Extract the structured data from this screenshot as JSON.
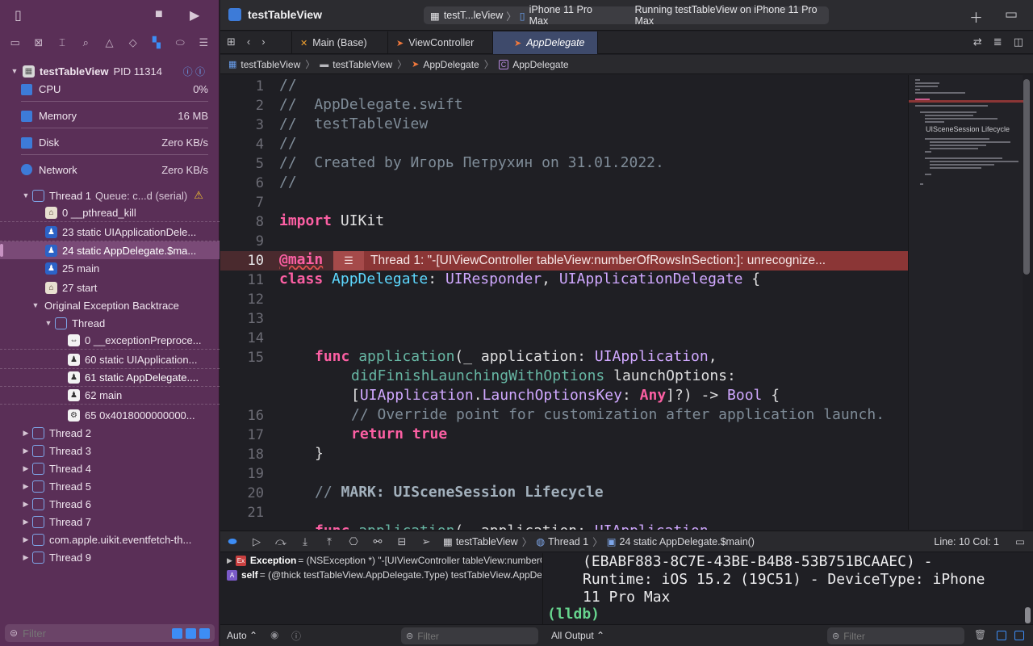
{
  "project_name": "testTableView",
  "activity": {
    "scheme": "testT...leView",
    "destination": "iPhone 11 Pro Max",
    "status": "Running testTableView on iPhone 11 Pro Max"
  },
  "process": {
    "name": "testTableView",
    "pid": "PID 11314"
  },
  "gauges": [
    {
      "label": "CPU",
      "value": "0%"
    },
    {
      "label": "Memory",
      "value": "16 MB"
    },
    {
      "label": "Disk",
      "value": "Zero KB/s"
    },
    {
      "label": "Network",
      "value": "Zero KB/s"
    }
  ],
  "thread1": {
    "label": "Thread 1",
    "queue": "Queue: c...d (serial)",
    "frames": [
      {
        "text": "0 __pthread_kill"
      },
      {
        "text": "23 static UIApplicationDele..."
      },
      {
        "text": "24 static AppDelegate.$ma..."
      },
      {
        "text": "25 main"
      },
      {
        "text": "27 start"
      }
    ]
  },
  "exception_backtrace": {
    "label": "Original Exception Backtrace",
    "thread_label": "Thread",
    "frames": [
      {
        "text": "0 __exceptionPreproce..."
      },
      {
        "text": "60 static UIApplication..."
      },
      {
        "text": "61 static AppDelegate...."
      },
      {
        "text": "62 main"
      },
      {
        "text": "65 0x4018000000000..."
      }
    ]
  },
  "threads": [
    "Thread 2",
    "Thread 3",
    "Thread 4",
    "Thread 5",
    "Thread 6",
    "Thread 7",
    "com.apple.uikit.eventfetch-th...",
    "Thread 9"
  ],
  "sidebar_filter_placeholder": "Filter",
  "tabs": [
    {
      "label": "Main (Base)"
    },
    {
      "label": "ViewController"
    },
    {
      "label": "AppDelegate"
    }
  ],
  "jumpbar": [
    "testTableView",
    "testTableView",
    "AppDelegate",
    "AppDelegate"
  ],
  "code": {
    "line_numbers": [
      "1",
      "2",
      "3",
      "4",
      "5",
      "6",
      "7",
      "8",
      "9",
      "10",
      "11",
      "12",
      "13",
      "14",
      "15",
      "",
      "",
      "16",
      "17",
      "18",
      "19",
      "20",
      "21"
    ],
    "lines": {
      "l1": "//",
      "l2": "//  AppDelegate.swift",
      "l3": "//  testTableView",
      "l4": "//",
      "l5": "//  Created by Игорь Петрухин on 31.01.2022.",
      "l6": "//",
      "l8_kw": "import",
      "l8_rest": " UIKit",
      "l10_kw": "@main",
      "l11_kw": "class",
      "l11_name": "AppDelegate",
      "l11_p1": ": ",
      "l11_t1": "UIResponder",
      "l11_p2": ", ",
      "l11_t2": "UIApplicationDelegate",
      "l11_p3": " {",
      "l15_kw": "func",
      "l15_fn": "application",
      "l15_p1": "(_ application: ",
      "l15_t1": "UIApplication",
      "l15_p2": ",",
      "l15b_fn": "didFinishLaunchingWithOptions",
      "l15b_p": " launchOptions:",
      "l15c_p1": "[",
      "l15c_t1": "UIApplication",
      "l15c_p2": ".",
      "l15c_t2": "LaunchOptionsKey",
      "l15c_p3": ": ",
      "l15c_t3": "Any",
      "l15c_p4": "]?) -> ",
      "l15c_t4": "Bool",
      "l15c_p5": " {",
      "l16": "// Override point for customization after application launch.",
      "l17_kw": "return",
      "l17_kw2": "true",
      "l18": "}",
      "l20_c": "// ",
      "l20_b": "MARK: UISceneSession Lifecycle",
      "l22_kw": "func",
      "l22_fn": "application",
      "l22_p": "(_ application: ",
      "l22_t": "UIApplication"
    },
    "error_message": "Thread 1: \"-[UIViewController tableView:numberOfRowsInSection:]: unrecognize..."
  },
  "minimap_label": "UISceneSession Lifecycle",
  "debugbar": {
    "crumbs": [
      "testTableView",
      "Thread 1",
      "24 static AppDelegate.$main()"
    ],
    "line_col": "Line: 10  Col: 1"
  },
  "variables": [
    {
      "badge": "Ex",
      "name": "Exception",
      "value": " = (NSException *) \"-[UIViewController tableView:numberO..."
    },
    {
      "badge": "A",
      "name": "self",
      "value": " = (@thick testTableView.AppDelegate.Type) testTableView.AppDele..."
    }
  ],
  "console": {
    "lines": [
      "(EBABF883-8C7E-43BE-B4B8-53B751BCAAEC) -",
      "Runtime: iOS 15.2 (19C51) - DeviceType: iPhone",
      "11 Pro Max"
    ],
    "prompt": "(lldb)"
  },
  "bottombar": {
    "auto_label": "Auto ⌃",
    "vars_filter_placeholder": "Filter",
    "output_label": "All Output ⌃",
    "console_filter_placeholder": "Filter"
  }
}
